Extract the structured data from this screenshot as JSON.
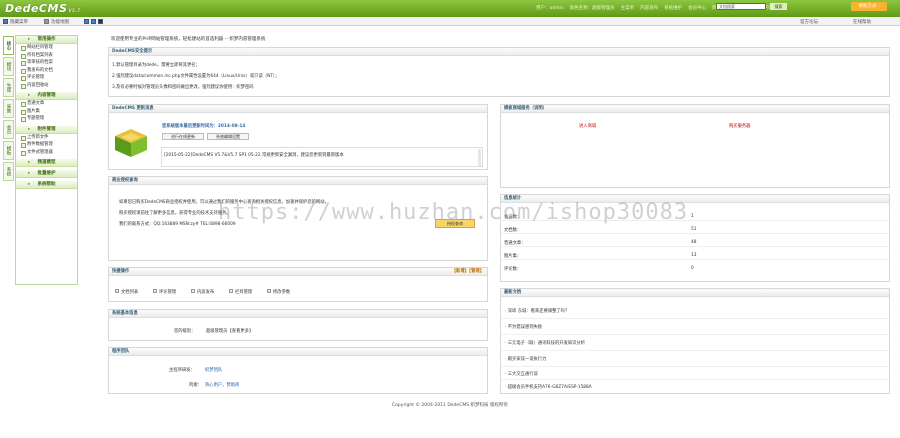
{
  "topbar": {
    "logo": "DedeCMS",
    "version": "V5.7",
    "links": [
      "用户：admin",
      "角色名称：超级管理员",
      "主菜单",
      "内容发布",
      "系统维护",
      "会员中心",
      "网站主页",
      "官方论坛",
      "官方帮助"
    ],
    "search_placeholder": "文档搜索",
    "search_btn": "搜索",
    "icons_text": [
      "官方论坛",
      "在线帮助"
    ],
    "skin_btn": "换肤方式 ·"
  },
  "subbar": {
    "left": [
      "隐藏菜单",
      "功能地图"
    ],
    "right": [
      "官方论坛",
      "在线帮助"
    ]
  },
  "vtabs": [
    "核心",
    "模块",
    "生成",
    "采集",
    "会员",
    "模板",
    "系统"
  ],
  "menu": {
    "sections": [
      {
        "title": "常用操作",
        "items": [
          "网站栏目管理",
          "所有档案列表",
          "等审核的档案",
          "我发布的文档",
          "评论管理",
          "内容回收站"
        ]
      },
      {
        "title": "内容管理",
        "items": [
          "普通文章",
          "图片集",
          "专题管理"
        ]
      },
      {
        "title": "附件管理",
        "items": [
          "上传新文件",
          "附件数据管理",
          "文件式管理器"
        ]
      },
      {
        "title": "频道模型",
        "items": []
      },
      {
        "title": "批量维护",
        "items": []
      },
      {
        "title": "系统帮助",
        "items": []
      }
    ]
  },
  "crumb": "欢迎使用专业的PHP网站管理系统，轻松建站的首选利器 -- 织梦内容管理系统",
  "security": {
    "title": "DedeCMS安全提示",
    "lines": [
      "1.默认管理目录为dede，需要立即将其更名；",
      "2.强烈建议data/common.inc.php文件属性设置为644（Linux/Unix）或只读（NT）；",
      "3.及有必要时候对管理员头像和密码做出更改，强烈建议你使用：织梦密码"
    ]
  },
  "update": {
    "title": "DedeCMS 更新消息",
    "headline": "您系统版本最后更新时间为：2014-08-14",
    "btn1": "进行在线更新",
    "btn2": "系统编辑设置",
    "news": "[2015-05-22]DedeCMS V5.7&V5.7 SP1 05-22 常规更新安全漏洞，建议您更新到最新版本"
  },
  "business": {
    "title": "商业授权查询",
    "lines": [
      "如果您已购买DedeCMS商业授权并使用，可以通过我们的服务中心查询相关授权信息，加速并保护您的网站，",
      "购买授权请前往了解更多信息，获得专业的技术支持服务。",
      "我们的联系方式：QQ:163889 MSN:zy#                   TEL:0898-66009"
    ],
    "btn": "授权查询"
  },
  "quick": {
    "title": "快捷操作",
    "right": "【新增】【管理】",
    "items": [
      "文档列表",
      "评论管理",
      "内容发布",
      "栏目管理",
      "修改参数"
    ]
  },
  "sysinfo": {
    "title": "系统基本信息",
    "label": "您的级别：",
    "value": "超级管理员【查看更多】"
  },
  "team": {
    "title": "程序团队",
    "rows": [
      {
        "label": "主程序研发：",
        "value": "织梦团队"
      },
      {
        "label": "鸣谢：",
        "value": "热心用户，赞助商"
      }
    ]
  },
  "cloud": {
    "title": "模板商城服务（说明）",
    "link1": "进入商城",
    "link2": "购买服务器"
  },
  "stats": {
    "title": "信息统计",
    "rows": [
      {
        "label": "会员数：",
        "value": "1"
      },
      {
        "label": "文档数：",
        "value": "51"
      },
      {
        "label": "普通文章：",
        "value": "48"
      },
      {
        "label": "图片集：",
        "value": "13"
      },
      {
        "label": "评论数：",
        "value": "0"
      }
    ]
  },
  "latest": {
    "title": "最新文档",
    "items": [
      "· 深圳 东城：看来还要调整了吗？",
      "· 不为错误感到失败",
      "· 三元电子（联）通讯科技的开发知识分析",
      "· 跟买家谈一谈执行力",
      "· 三大交互通行谈",
      "· 超级会员手机支持A76-G6Z7A/ESP-1588A"
    ]
  },
  "footer": "Copyright © 2004-2011 DedeCMS 织梦科技 版权所有",
  "watermark": "https://www.huzhan.com/ishop30083"
}
